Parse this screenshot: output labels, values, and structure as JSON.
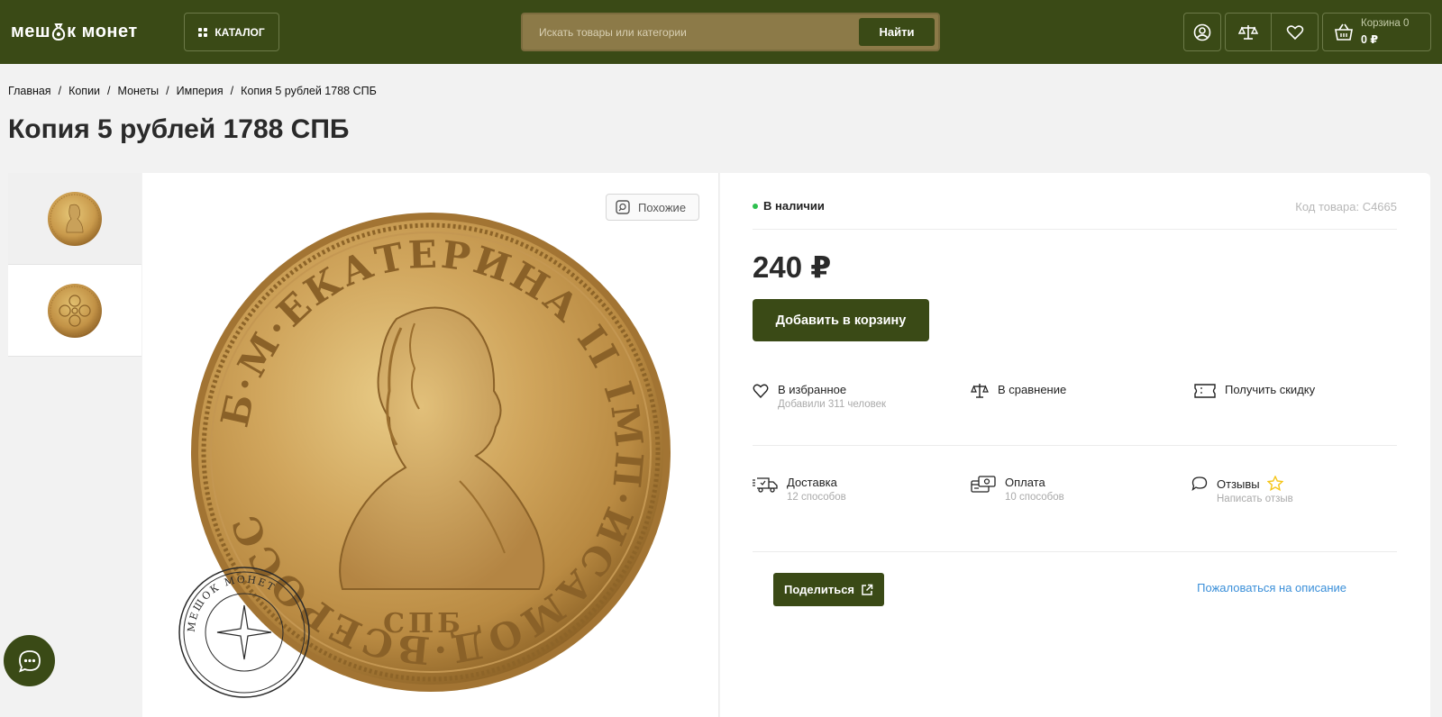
{
  "header": {
    "logo_left": "меш",
    "logo_right": "к монет",
    "catalog_label": "КАТАЛОГ",
    "search_placeholder": "Искать товары или категории",
    "search_button": "Найти",
    "cart_label": "Корзина 0",
    "cart_sum": "0 ₽"
  },
  "breadcrumb": [
    "Главная",
    "Копии",
    "Монеты",
    "Империя",
    "Копия 5 рублей 1788 СПБ"
  ],
  "product": {
    "title": "Копия 5 рублей 1788 СПБ",
    "similar_label": "Похожие",
    "stock": "В наличии",
    "code": "Код товара: C4665",
    "price": "240 ₽",
    "add_to_cart": "Добавить в корзину",
    "favorite": {
      "title": "В избранное",
      "sub": "Добавили 311 человек"
    },
    "compare": {
      "title": "В сравнение"
    },
    "discount": {
      "title": "Получить скидку"
    },
    "delivery": {
      "title": "Доставка",
      "sub": "12 способов"
    },
    "payment": {
      "title": "Оплата",
      "sub": "10 способов"
    },
    "reviews": {
      "title": "Отзывы",
      "sub": "Написать отзыв"
    },
    "share": "Поделиться",
    "complain": "Пожаловаться на описание",
    "coin_legend": "Б·М·ЕКАТЕРИНА II IMП·ИСАМОД·ВСЕРОСС",
    "coin_mint": "СПБ",
    "stamp_text": "МЕШОК МОНЕТ"
  },
  "colors": {
    "header_bg": "#3a4a16",
    "accent": "#3a4a16",
    "stock_dot": "#2ec04f",
    "link": "#3a8fd9",
    "star": "#f5c518"
  }
}
